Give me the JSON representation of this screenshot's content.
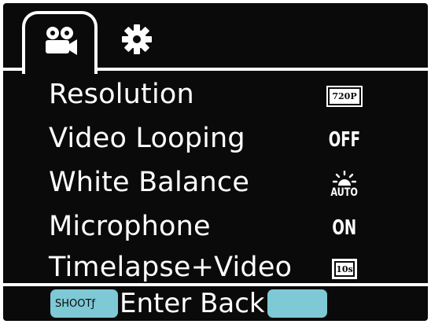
{
  "tabs": [
    {
      "icon": "video-camera-icon",
      "active": true
    },
    {
      "icon": "gear-icon",
      "active": false
    }
  ],
  "menu": {
    "items": [
      {
        "label": "Resolution",
        "value": "720P"
      },
      {
        "label": "Video Looping",
        "value": "OFF"
      },
      {
        "label": "White Balance",
        "value": "AUTO",
        "icon": "sun-icon"
      },
      {
        "label": "Microphone",
        "value": "ON"
      },
      {
        "label": "Timelapse+Video",
        "value": "10s"
      }
    ]
  },
  "bottom_bar": {
    "shoot_button_label": "SHOOTƒ",
    "text": "Enter Back"
  },
  "colors": {
    "background": "#0a0a0a",
    "foreground": "#ffffff",
    "button": "#7fc8d6"
  }
}
